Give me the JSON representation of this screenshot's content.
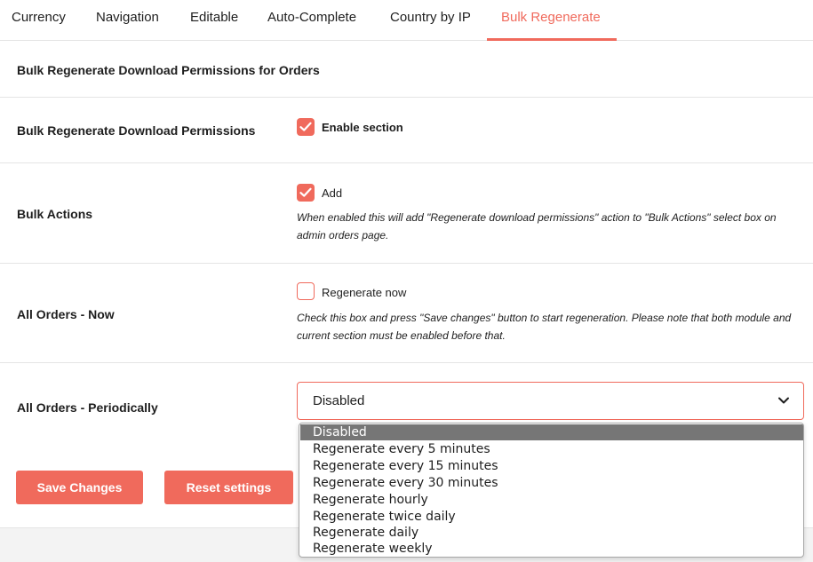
{
  "tabs": [
    {
      "label": "Currency"
    },
    {
      "label": "Navigation"
    },
    {
      "label": "Editable"
    },
    {
      "label": "Auto-Complete"
    },
    {
      "label": "Country by IP"
    },
    {
      "label": "Bulk Regenerate",
      "active": true
    }
  ],
  "section": {
    "title": "Bulk Regenerate Download Permissions for Orders"
  },
  "rows": {
    "enable": {
      "label": "Bulk Regenerate Download Permissions",
      "checkbox_label": "Enable section",
      "checked": true
    },
    "bulk_actions": {
      "label": "Bulk Actions",
      "checkbox_label": "Add",
      "checked": true,
      "description": "When enabled this will add \"Regenerate download permissions\" action to \"Bulk Actions\" select box on admin orders page."
    },
    "now": {
      "label": "All Orders - Now",
      "checkbox_label": "Regenerate now",
      "checked": false,
      "description": "Check this box and press \"Save changes\" button to start regeneration. Please note that both module and current section must be enabled before that."
    },
    "periodic": {
      "label": "All Orders - Periodically",
      "selected_value": "Disabled",
      "options": [
        "Disabled",
        "Regenerate every 5 minutes",
        "Regenerate every 15 minutes",
        "Regenerate every 30 minutes",
        "Regenerate hourly",
        "Regenerate twice daily",
        "Regenerate daily",
        "Regenerate weekly"
      ]
    }
  },
  "buttons": {
    "save": "Save Changes",
    "reset": "Reset settings"
  },
  "colors": {
    "accent": "#f06a5c",
    "selected_option_bg": "#767676"
  },
  "icons": {
    "check": "checkmark-icon",
    "chevron": "chevron-down-icon"
  }
}
